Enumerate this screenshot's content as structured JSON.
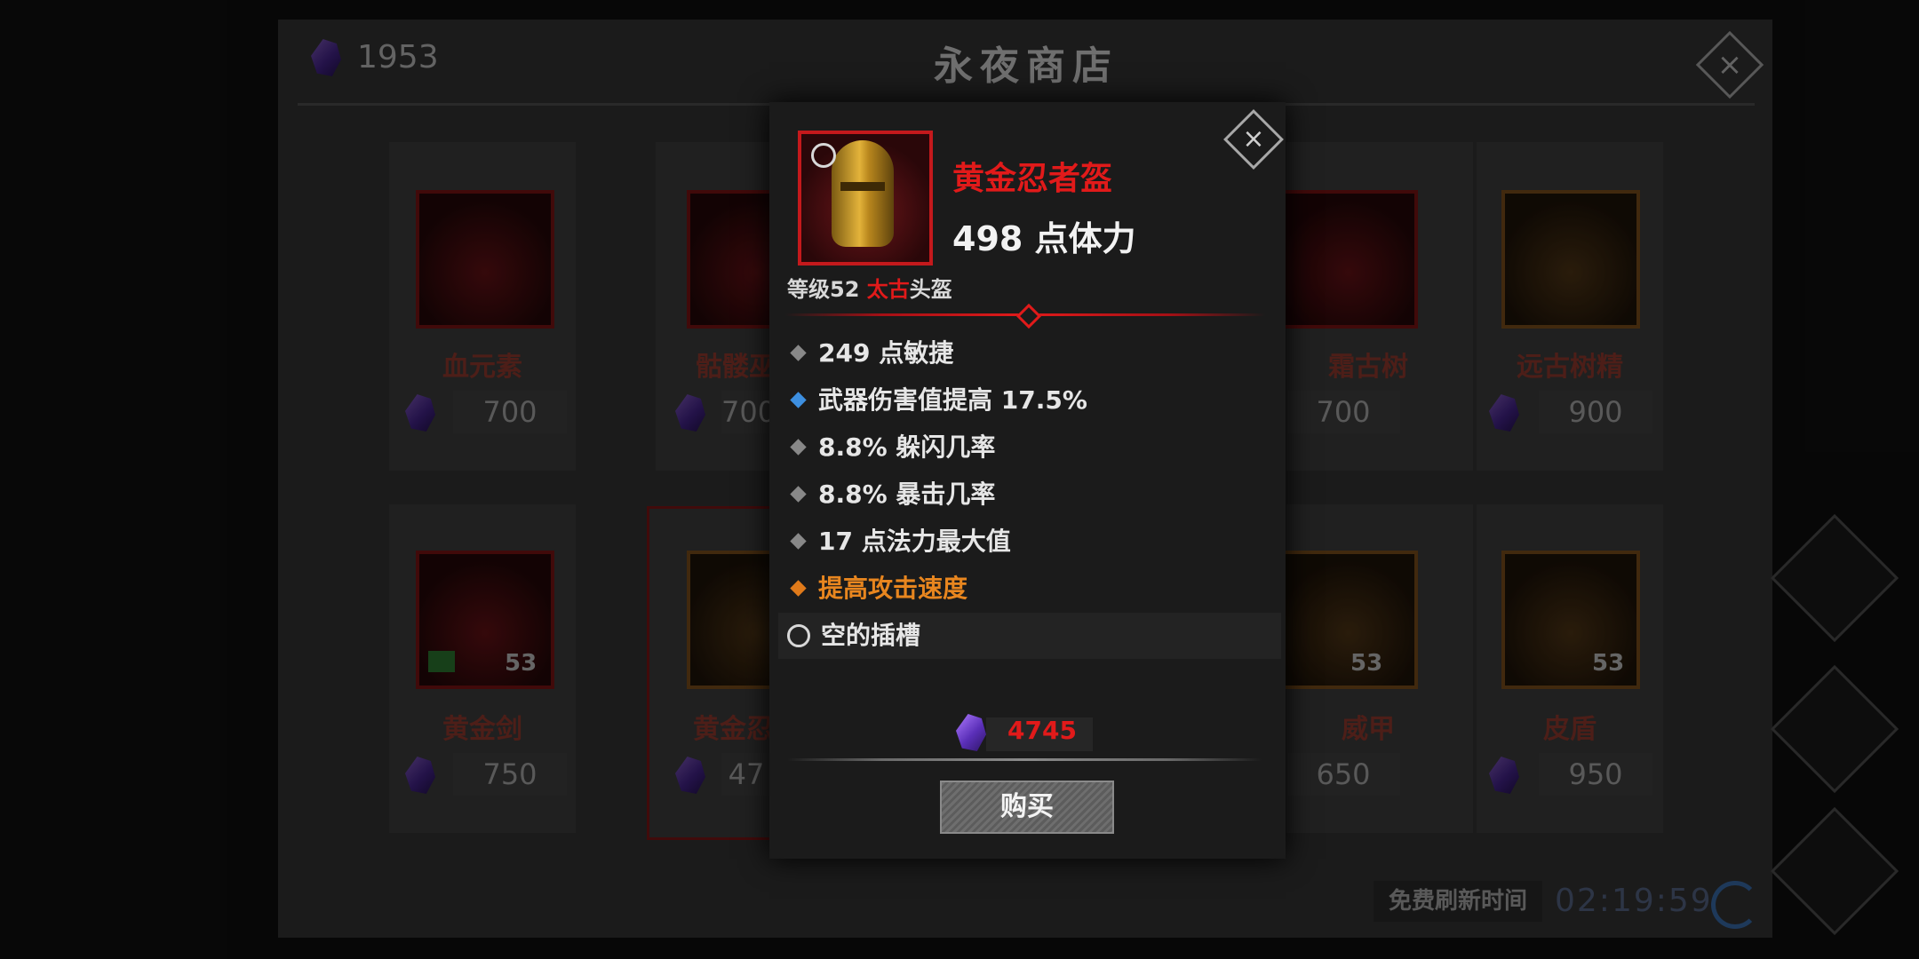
{
  "shop": {
    "title": "永夜商店",
    "currency_amount": "1953",
    "cards": [
      {
        "name": "血元素",
        "price": "700"
      },
      {
        "name": "骷髅巫",
        "price": "700"
      },
      {
        "name": "霜古树",
        "price": "700"
      },
      {
        "name": "远古树精",
        "price": "900"
      },
      {
        "name": "黄金剑",
        "price": "750",
        "level": "53"
      },
      {
        "name": "黄金忍",
        "price": "47"
      },
      {
        "name": "威甲",
        "price": "650",
        "level": "53"
      },
      {
        "name": "皮盾",
        "price": "950",
        "level": "53"
      }
    ],
    "refresh_label": "免费刷新时间",
    "refresh_time": "02:19:59"
  },
  "popup": {
    "item_name": "黄金忍者盔",
    "main_stat": "498 点体力",
    "level_prefix": "等级52 ",
    "rarity": "太古",
    "item_type": "头盔",
    "stats": [
      {
        "text": "249 点敏捷",
        "color": "#888888",
        "text_color": "#e6e6e6"
      },
      {
        "text": "武器伤害值提高 17.5%",
        "color": "#3d8fe0",
        "text_color": "#e6e6e6"
      },
      {
        "text": "8.8% 躲闪几率",
        "color": "#888888",
        "text_color": "#e6e6e6"
      },
      {
        "text": "8.8% 暴击几率",
        "color": "#888888",
        "text_color": "#e6e6e6"
      },
      {
        "text": "17 点法力最大值",
        "color": "#888888",
        "text_color": "#e6e6e6"
      },
      {
        "text": "提高攻击速度",
        "color": "#e07a1a",
        "text_color": "#e8861f"
      }
    ],
    "socket_label": "空的插槽",
    "price": "4745",
    "buy_label": "购买"
  }
}
